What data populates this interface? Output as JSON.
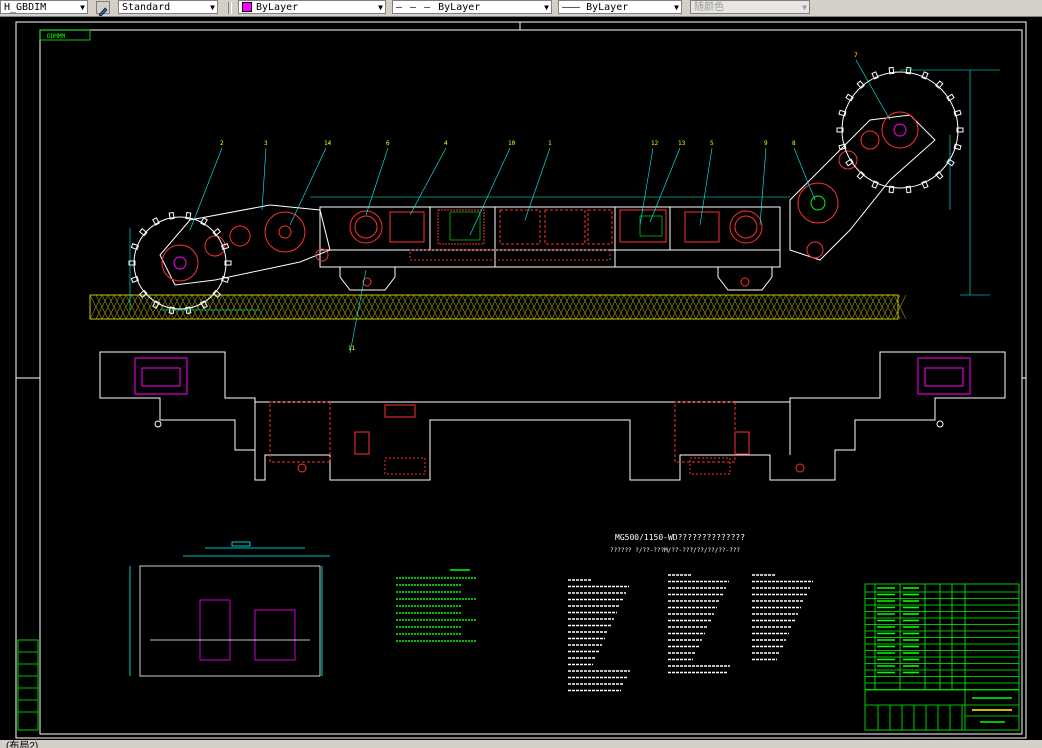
{
  "toolbar": {
    "dimstyle_value": "H_GBDIM",
    "textstyle_value": "Standard",
    "layer_value": "ByLayer",
    "linetype_value": "ByLayer",
    "lineweight_value": "ByLayer",
    "plotstyle_value": "随颜色",
    "layer_color": "#ff00ff"
  },
  "drawing": {
    "frame_tag": "DDMMM",
    "main_title": "MG500/1150-WD??????????????",
    "subtitle": "??????  ?/??-???M/??-???/??/??/??-???",
    "labels": [
      "2",
      "3",
      "14",
      "6",
      "4",
      "10",
      "1",
      "12",
      "13",
      "5",
      "9",
      "8",
      "7",
      "11"
    ]
  },
  "statusbar": {
    "tab_label": "(布局2)"
  },
  "colors": {
    "background": "#000000",
    "frame": "#ffffff",
    "machine": "#ffffff",
    "parts_red": "#ff3030",
    "dims": "#00ffff",
    "notes": "#00ff00",
    "magenta": "#ff00ff",
    "ground": "#c8c800"
  }
}
